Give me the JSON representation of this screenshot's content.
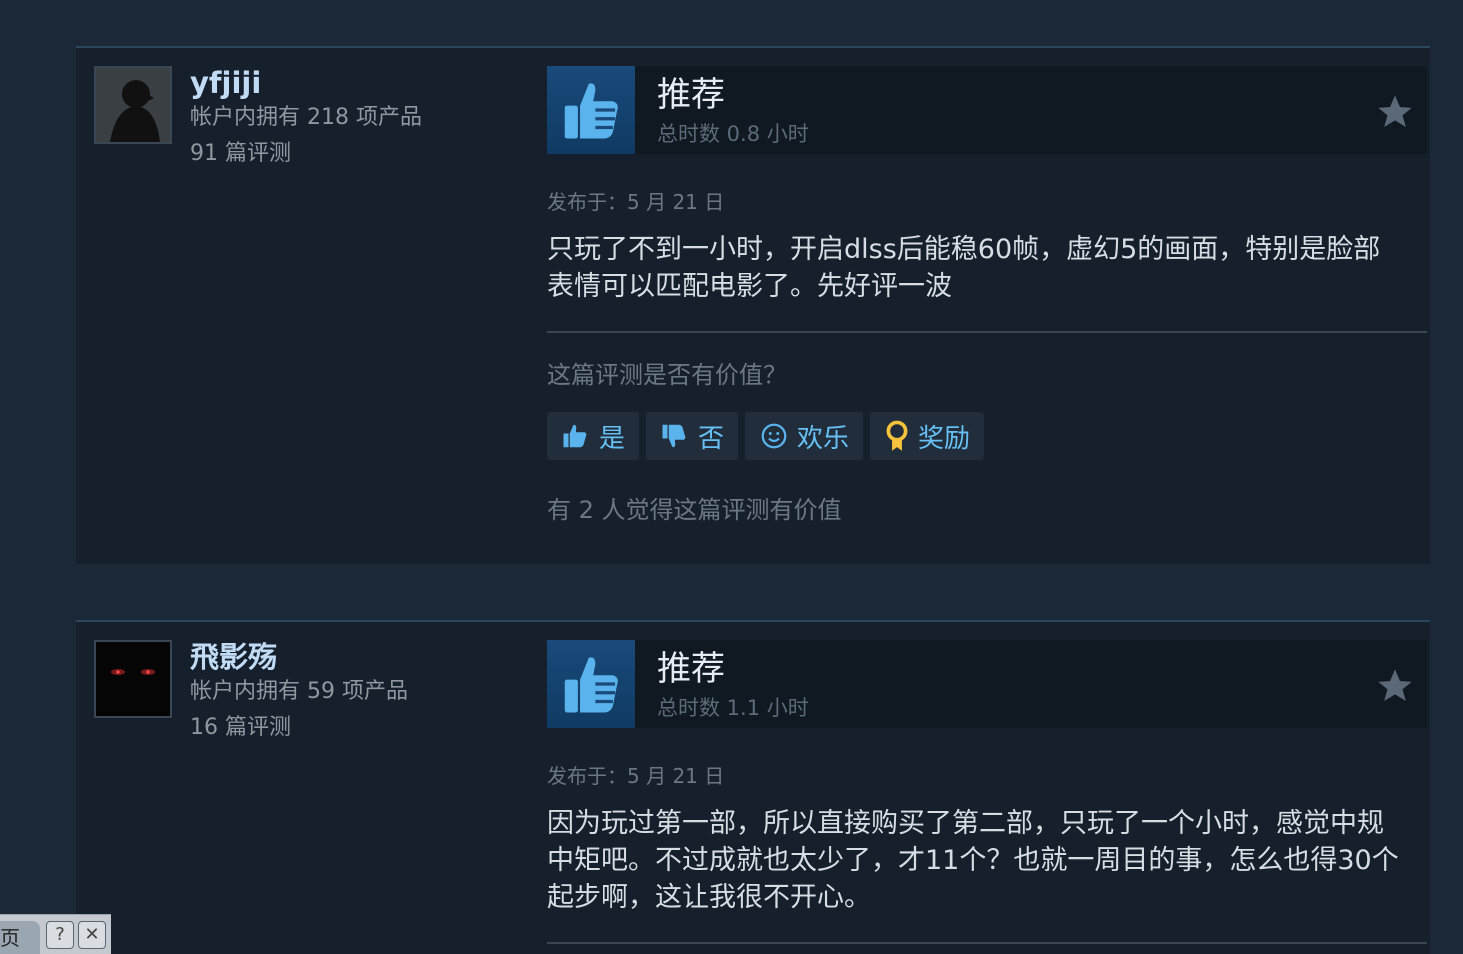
{
  "reviews": [
    {
      "author": {
        "name": "yfjiji",
        "owned": "帐户内拥有 218 项产品",
        "review_count": "91 篇评测"
      },
      "verdict": "推荐",
      "hours": "总时数 0.8 小时",
      "posted": "发布于：5 月 21 日",
      "text": "只玩了不到一小时，开启dlss后能稳60帧，虚幻5的画面，特别是脸部表情可以匹配电影了。先好评一波",
      "helpful_question": "这篇评测是否有价值？",
      "buttons": {
        "yes": "是",
        "no": "否",
        "funny": "欢乐",
        "award": "奖励"
      },
      "helpful_count": "有 2 人觉得这篇评测有价值"
    },
    {
      "author": {
        "name": "飛影殇",
        "owned": "帐户内拥有 59 项产品",
        "review_count": "16 篇评测"
      },
      "verdict": "推荐",
      "hours": "总时数 1.1 小时",
      "posted": "发布于：5 月 21 日",
      "text": "因为玩过第一部，所以直接购买了第二部，只玩了一个小时，感觉中规中矩吧。不过成就也太少了，才11个？也就一周目的事，怎么也得30个起步啊，这让我很不开心。"
    }
  ],
  "float_bar": {
    "tab_label": "页",
    "help": "?",
    "close": "✕"
  },
  "colors": {
    "background": "#1b2838",
    "card": "#16202d",
    "link": "#66c0f4",
    "thumb": "#1a4a7a"
  }
}
